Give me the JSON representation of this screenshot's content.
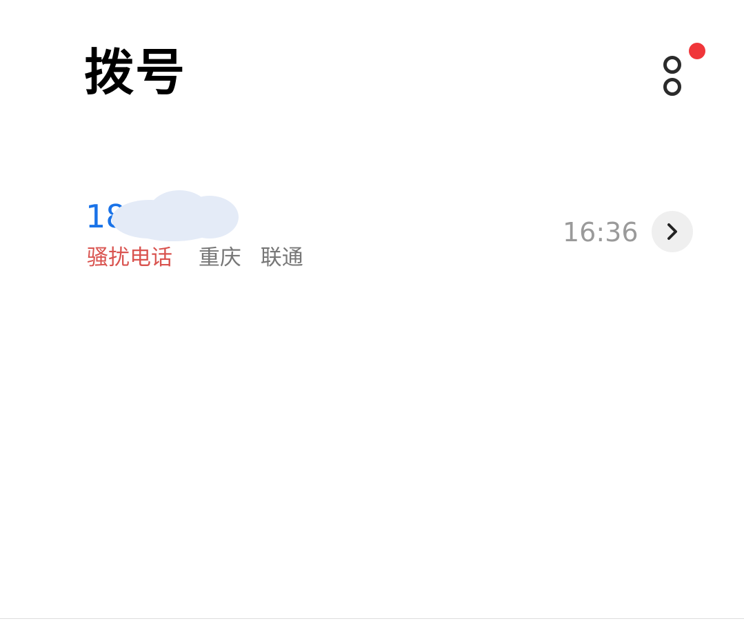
{
  "header": {
    "title": "拨号",
    "more_icon": "more-options-icon",
    "badge_color": "#f0363a"
  },
  "call_log": [
    {
      "number": "18     5716",
      "tag": "骚扰电话",
      "location": "重庆",
      "carrier": "联通",
      "time": "16:36",
      "detail_icon": "chevron-right-icon"
    }
  ],
  "colors": {
    "number": "#1a73e8",
    "spam_tag": "#d9534f",
    "secondary_text": "#777777",
    "time": "#9a9a9a"
  }
}
